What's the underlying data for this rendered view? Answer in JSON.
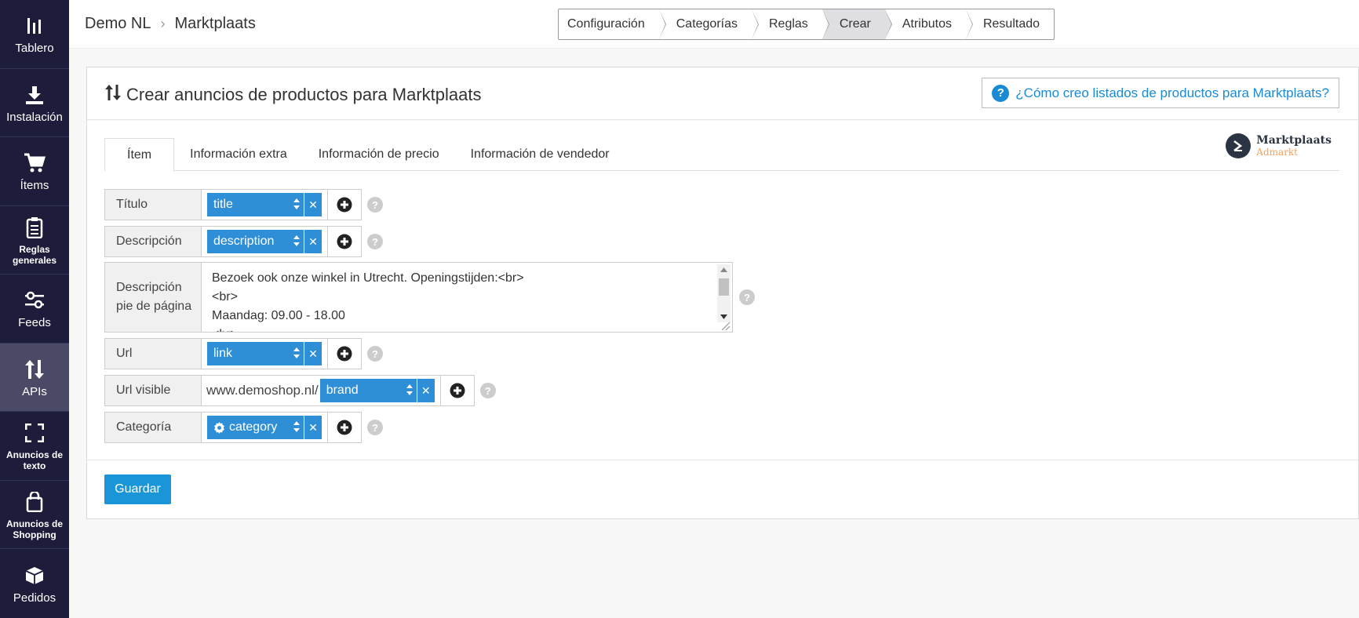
{
  "sidebar": {
    "items": [
      {
        "label": "Tablero",
        "icon": "dashboard-icon"
      },
      {
        "label": "Instalación",
        "icon": "download-icon"
      },
      {
        "label": "Ítems",
        "icon": "cart-icon"
      },
      {
        "label": "Reglas generales",
        "icon": "clipboard-icon"
      },
      {
        "label": "Feeds",
        "icon": "sliders-icon"
      },
      {
        "label": "APIs",
        "icon": "updown-arrows-icon",
        "active": true
      },
      {
        "label": "Anuncios de texto",
        "icon": "expand-icon"
      },
      {
        "label": "Anuncios de Shopping",
        "icon": "shopping-bag-icon"
      },
      {
        "label": "Pedidos",
        "icon": "box-icon"
      }
    ]
  },
  "header": {
    "breadcrumb": [
      "Demo NL",
      "Marktplaats"
    ],
    "steps": [
      "Configuración",
      "Categorías",
      "Reglas",
      "Crear",
      "Atributos",
      "Resultado"
    ],
    "active_step": "Crear"
  },
  "panel": {
    "title": "Crear anuncios de productos para Marktplaats",
    "help_link": "¿Cómo creo listados de productos para Marktplaats?",
    "tabs": [
      "Ítem",
      "Información extra",
      "Información de precio",
      "Información de vendedor"
    ],
    "logo": {
      "name": "Marktplaats",
      "sub": "Admarkt"
    }
  },
  "form": {
    "titulo": {
      "label": "Título",
      "value": "title"
    },
    "descripcion": {
      "label": "Descripción",
      "value": "description"
    },
    "footer": {
      "label_line1": "Descripción",
      "label_line2": "pie de página",
      "line1": "Bezoek ook onze winkel in Utrecht. Openingstijden:<br>",
      "line2": "<br>",
      "line3": "Maandag: 09.00 - 18.00",
      "line4": "<br>"
    },
    "url": {
      "label": "Url",
      "value": "link"
    },
    "url_visible": {
      "label": "Url visible",
      "prefix": "www.demoshop.nl/",
      "value": "brand"
    },
    "categoria": {
      "label": "Categoría",
      "value": "category"
    }
  },
  "actions": {
    "save": "Guardar"
  },
  "colors": {
    "sidebar": "#1d1c3a",
    "accent": "#2f8fd6",
    "link": "#1a8ad4"
  }
}
